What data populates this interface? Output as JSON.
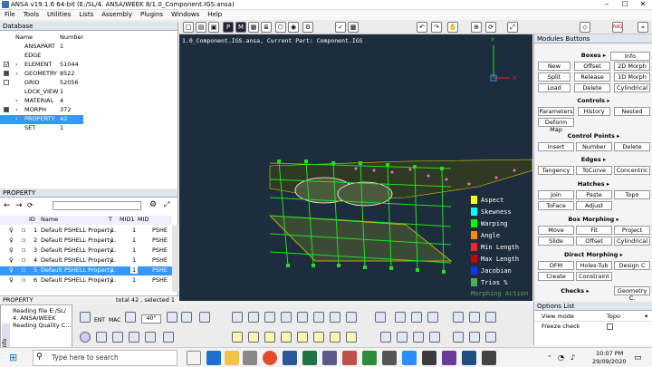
{
  "window": {
    "title": "ANSA v19.1.6 64-bit (E:/SL/4. ANSA/WEEK 8/1.0_Component.IGS.ansa)"
  },
  "menu": [
    "File",
    "Tools",
    "Utilities",
    "Lists",
    "Assembly",
    "Plugins",
    "Windows",
    "Help"
  ],
  "database": {
    "header": "Database",
    "col_name": "Name",
    "col_number": "Number",
    "rows": [
      {
        "name": "ANSAPART",
        "number": "1"
      },
      {
        "name": "EDGE",
        "number": ""
      },
      {
        "name": "ELEMENT",
        "number": "51044"
      },
      {
        "name": "GEOMETRY",
        "number": "8522"
      },
      {
        "name": "GRID",
        "number": "52056"
      },
      {
        "name": "LOCK_VIEW",
        "number": "1"
      },
      {
        "name": "MATERIAL",
        "number": "4"
      },
      {
        "name": "MORPH",
        "number": "372"
      },
      {
        "name": "PROPERTY",
        "number": "42"
      },
      {
        "name": "SET",
        "number": "1"
      }
    ]
  },
  "property": {
    "header": "PROPERTY",
    "columns": [
      "ID",
      "Name",
      "T",
      "MID1",
      "MID",
      "..."
    ],
    "rows": [
      {
        "id": "1",
        "name": "Default PSHELL Property",
        "t": "1.",
        "mid1": "1",
        "type": "PSHE"
      },
      {
        "id": "2",
        "name": "Default PSHELL Property",
        "t": "1.",
        "mid1": "1",
        "type": "PSHE"
      },
      {
        "id": "3",
        "name": "Default PSHELL Property",
        "t": "1.",
        "mid1": "1",
        "type": "PSHE"
      },
      {
        "id": "4",
        "name": "Default PSHELL Property",
        "t": "1.",
        "mid1": "1",
        "type": "PSHE"
      },
      {
        "id": "5",
        "name": "Default PSHELL Property",
        "t": "1.",
        "mid1": "1",
        "type": "PSHE"
      },
      {
        "id": "6",
        "name": "Default PSHELL Property",
        "t": "1.",
        "mid1": "1",
        "type": "PSHE"
      }
    ],
    "footer_left": "PROPERTY",
    "footer_right": "total 42 , selected 1"
  },
  "info": {
    "label": "Info",
    "lines": [
      "Reading file E:/SL/",
      "4. ANSA/WEEK",
      "Reading Quality C..."
    ]
  },
  "viewport": {
    "caption": "1.0_Component.IGS.ansa,  Current Part: Component.IGS",
    "legend": [
      {
        "label": "Aspect",
        "color": "#ffff00"
      },
      {
        "label": "Skewness",
        "color": "#00ffff"
      },
      {
        "label": "Warping",
        "color": "#00ff00"
      },
      {
        "label": "Angle",
        "color": "#ff8800"
      },
      {
        "label": "Min Length",
        "color": "#ff2222"
      },
      {
        "label": "Max Length",
        "color": "#cc0000"
      },
      {
        "label": "Jacobian",
        "color": "#1133ff"
      },
      {
        "label": "Trias %",
        "color": "#55aa55"
      },
      {
        "label": "Morphing Action",
        "color": "#55aa55"
      }
    ],
    "axis_y": "Y",
    "axis_x": "X"
  },
  "modules": {
    "header": "Modules Buttons",
    "sections": [
      {
        "title": "Boxes",
        "buttons": [
          "New",
          "Offset",
          "2D Morph",
          "Split",
          "Release",
          "1D Morph",
          "Load",
          "Delete",
          "Cylindrical"
        ]
      },
      {
        "title": "Controls",
        "buttons": [
          "Parameters",
          "History",
          "Nested",
          "Deform Map"
        ]
      },
      {
        "title": "Control Points",
        "buttons": [
          "Insert",
          "Number",
          "Delete"
        ]
      },
      {
        "title": "Edges",
        "buttons": [
          "Tangency",
          "ToCurve",
          "Concentric"
        ]
      },
      {
        "title": "Hatches",
        "buttons": [
          "Join",
          "Paste",
          "Topo",
          "ToFace",
          "Adjust"
        ]
      },
      {
        "title": "Box Morphing",
        "buttons": [
          "Move",
          "Fit",
          "Project",
          "Slide",
          "Offset",
          "Cylindrical"
        ]
      },
      {
        "title": "Direct Morphing",
        "buttons": [
          "DFM",
          "Holes-Tub",
          "Design C",
          "Create",
          "Constraint"
        ]
      },
      {
        "title": "Checks",
        "buttons": [
          "Geometry C."
        ]
      }
    ],
    "info_button": "Info"
  },
  "options": {
    "header": "Options List",
    "rows": [
      {
        "name": "View mode",
        "value": "Topo"
      },
      {
        "name": "Freeze check",
        "value": ""
      }
    ]
  },
  "bottombar": {
    "zoom": "40°",
    "labels": [
      "ENT",
      "MAC"
    ]
  },
  "taskbar": {
    "search_placeholder": "Type here to search",
    "time": "10:07 PM",
    "date": "29/09/2020"
  },
  "colors": {
    "viewport_bg": "#1e2d3d",
    "selection": "#3399ff",
    "mesh_green": "#22dd22"
  }
}
